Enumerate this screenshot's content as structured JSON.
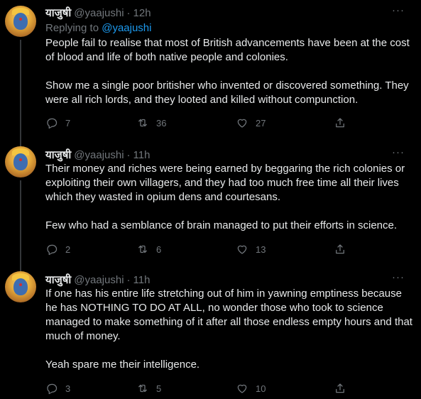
{
  "tweets": [
    {
      "author": "याजुषी",
      "handle": "@yaajushi",
      "separator": "·",
      "time": "12h",
      "replying_prefix": "Replying to ",
      "replying_to": "@yaajushi",
      "paragraphs": [
        "People fail to realise that most of British advancements have been at the cost of blood and life of both native people and colonies.",
        "Show me a single poor britisher who invented or discovered something. They were all rich lords, and they looted and killed without compunction."
      ],
      "replies": "7",
      "retweets": "36",
      "likes": "27"
    },
    {
      "author": "याजुषी",
      "handle": "@yaajushi",
      "separator": "·",
      "time": "11h",
      "paragraphs": [
        "Their money and riches were being earned by beggaring the rich colonies or exploiting their own villagers, and they had too much free time all their lives which they wasted in opium dens and courtesans.",
        "Few who had a semblance of brain managed to put their efforts in science."
      ],
      "replies": "2",
      "retweets": "6",
      "likes": "13"
    },
    {
      "author": "याजुषी",
      "handle": "@yaajushi",
      "separator": "·",
      "time": "11h",
      "paragraphs": [
        "If one has his entire life stretching out of him in yawning emptiness because he has NOTHING TO DO AT ALL, no wonder those who took to science managed to make something of it after all those endless empty hours and that much of money.",
        "Yeah spare me their intelligence."
      ],
      "replies": "3",
      "retweets": "5",
      "likes": "10"
    }
  ],
  "icons": {
    "more": "ellipsis-icon",
    "reply": "reply-icon",
    "retweet": "retweet-icon",
    "like": "heart-icon",
    "share": "share-icon"
  },
  "colors": {
    "background": "#000000",
    "text": "#e7e9ea",
    "muted": "#71767b",
    "link": "#1d9bf0",
    "thread_line": "#333639"
  }
}
